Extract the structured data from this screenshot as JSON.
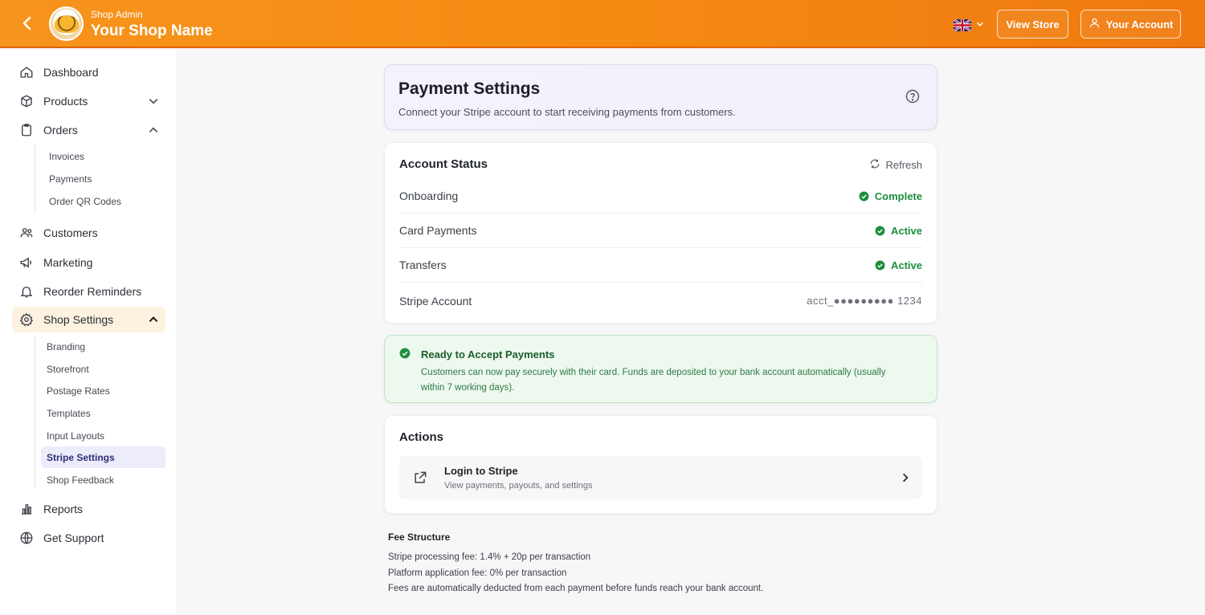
{
  "header": {
    "brand_sub": "Shop Admin",
    "brand_title": "Your Shop Name",
    "view_store": "View Store",
    "your_account": "Your Account"
  },
  "sidebar": {
    "dashboard": "Dashboard",
    "products": "Products",
    "orders": "Orders",
    "orders_sub": [
      "Invoices",
      "Payments",
      "Order QR Codes"
    ],
    "customers": "Customers",
    "marketing": "Marketing",
    "reorder": "Reorder Reminders",
    "shop_settings": "Shop Settings",
    "settings_sub": [
      "Branding",
      "Storefront",
      "Postage Rates",
      "Templates",
      "Input Layouts",
      "Stripe Settings",
      "Shop Feedback"
    ],
    "reports": "Reports",
    "support": "Get Support"
  },
  "page": {
    "title": "Payment Settings",
    "subtitle": "Connect your Stripe account to start receiving payments from customers."
  },
  "status": {
    "heading": "Account Status",
    "refresh": "Refresh",
    "rows": [
      {
        "label": "Onboarding",
        "value": "Complete"
      },
      {
        "label": "Card Payments",
        "value": "Active"
      },
      {
        "label": "Transfers",
        "value": "Active"
      }
    ],
    "stripe_label": "Stripe Account",
    "stripe_value": "acct_●●●●●●●●● 1234"
  },
  "ready": {
    "title": "Ready to Accept Payments",
    "text": "Customers can now pay securely with their card. Funds are deposited to your bank account automatically (usually within 7 working days)."
  },
  "actions": {
    "heading": "Actions",
    "login_title": "Login to Stripe",
    "login_sub": "View payments, payouts, and settings"
  },
  "fees": {
    "heading": "Fee Structure",
    "lines": [
      "Stripe processing fee: 1.4% + 20p per transaction",
      "Platform application fee: 0% per transaction",
      "Fees are automatically deducted from each payment before funds reach your bank account."
    ]
  },
  "colors": {
    "accent": "#f7941d",
    "success": "#1e8e3e",
    "active_nav": "#fdf1df"
  }
}
